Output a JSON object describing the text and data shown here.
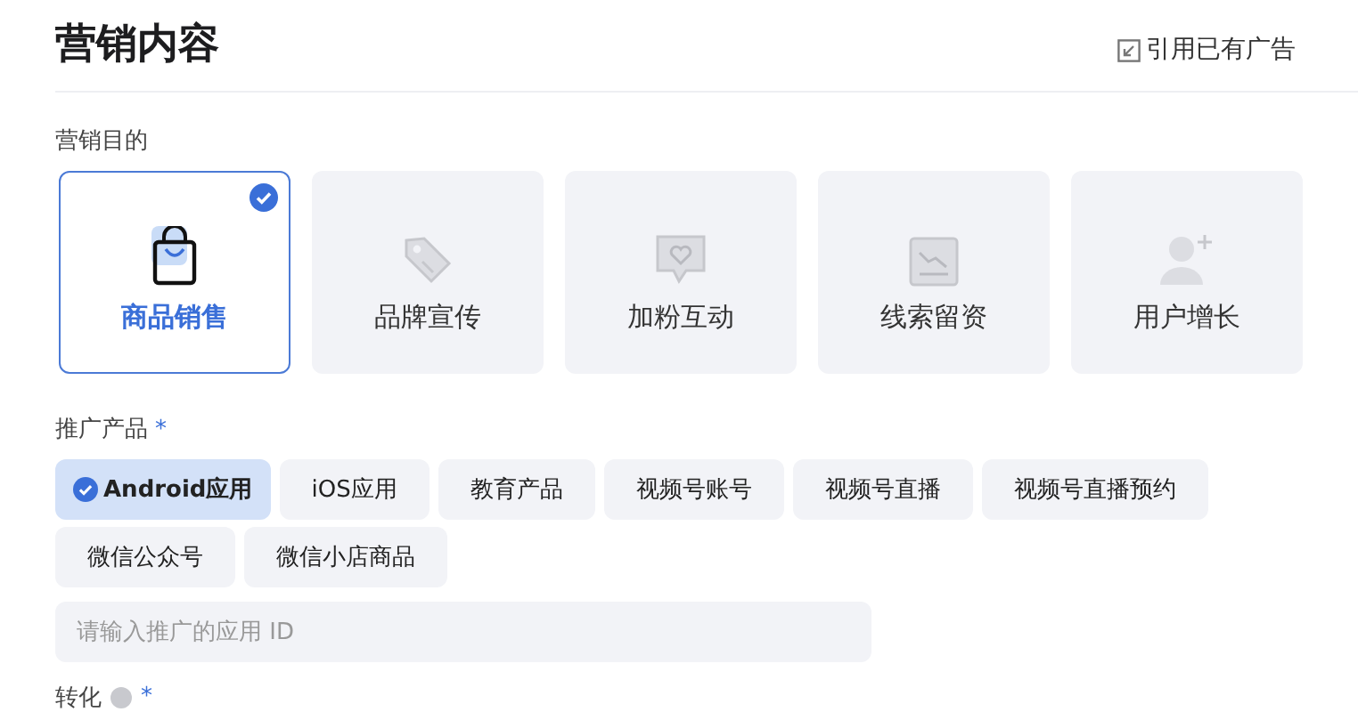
{
  "title": "营销内容",
  "reuse_link": "引用已有广告",
  "objective": {
    "label": "营销目的",
    "options": [
      {
        "label": "商品销售",
        "kind": "bag",
        "selected": true
      },
      {
        "label": "品牌宣传",
        "kind": "tag",
        "selected": false
      },
      {
        "label": "加粉互动",
        "kind": "heart",
        "selected": false
      },
      {
        "label": "线索留资",
        "kind": "form",
        "selected": false
      },
      {
        "label": "用户增长",
        "kind": "user",
        "selected": false
      }
    ]
  },
  "product": {
    "label": "推广产品",
    "required_mark": "*",
    "options": [
      {
        "label": "Android应用",
        "selected": true
      },
      {
        "label": "iOS应用",
        "selected": false
      },
      {
        "label": "教育产品",
        "selected": false
      },
      {
        "label": "视频号账号",
        "selected": false
      },
      {
        "label": "视频号直播",
        "selected": false
      },
      {
        "label": "视频号直播预约",
        "selected": false
      },
      {
        "label": "微信公众号",
        "selected": false
      },
      {
        "label": "微信小店商品",
        "selected": false
      }
    ],
    "placeholder": "请输入推广的应用 ID"
  },
  "conversion": {
    "label": "转化",
    "required_mark": "*"
  }
}
